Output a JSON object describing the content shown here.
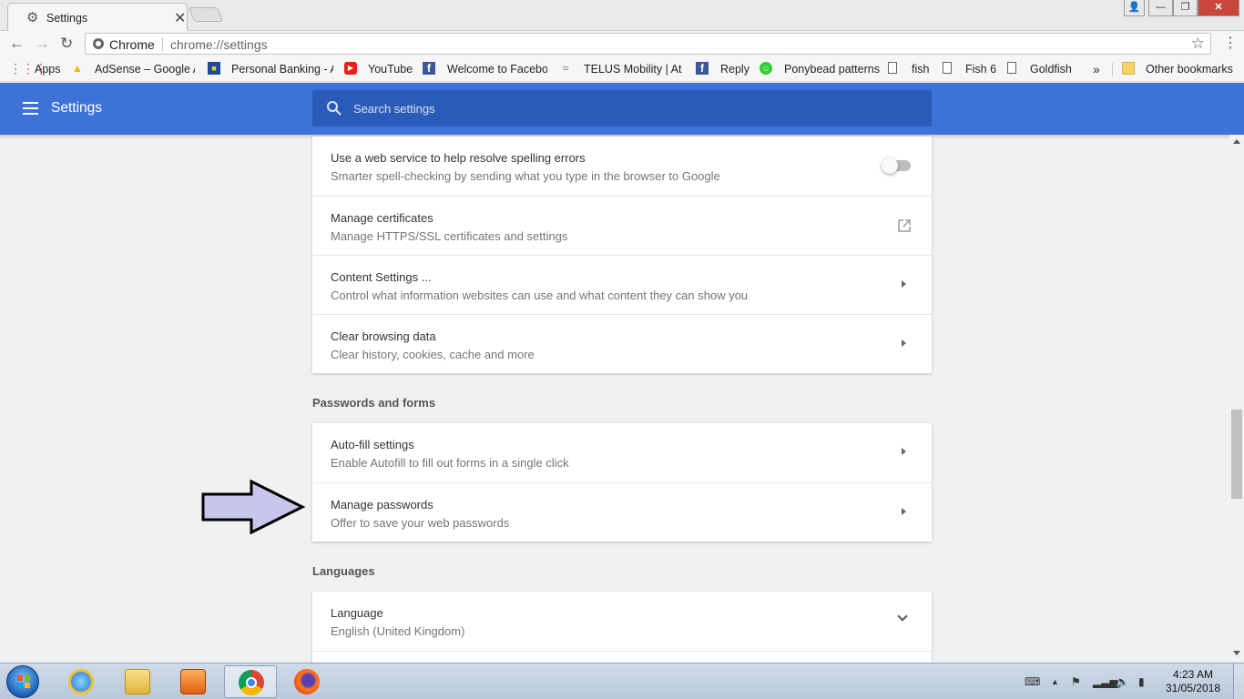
{
  "tab": {
    "title": "Settings",
    "close": "✕"
  },
  "window_controls": {
    "user": "👤",
    "minimize": "—",
    "maximize": "❐",
    "close": "✕"
  },
  "toolbar": {
    "back": "←",
    "forward": "→",
    "reload": "↻",
    "chip_label": "Chrome",
    "url": "chrome://settings",
    "star": "☆",
    "menu": "⋮"
  },
  "bookmarks": {
    "items": [
      {
        "label": "Apps",
        "icon": "apps-grid-icon"
      },
      {
        "label": "AdSense – Google A",
        "icon": "adsense-icon"
      },
      {
        "label": "Personal Banking - A",
        "icon": "bank-icon"
      },
      {
        "label": "YouTube",
        "icon": "youtube-icon"
      },
      {
        "label": "Welcome to Facebo",
        "icon": "facebook-icon"
      },
      {
        "label": "TELUS Mobility | At T",
        "icon": "telus-icon"
      },
      {
        "label": "Reply",
        "icon": "facebook-icon"
      },
      {
        "label": "Ponybead patterns",
        "icon": "ponybead-icon"
      },
      {
        "label": "fish",
        "icon": "page-icon"
      },
      {
        "label": "Fish 6",
        "icon": "page-icon"
      },
      {
        "label": "Goldfish",
        "icon": "page-icon"
      }
    ],
    "overflow": "»",
    "other": "Other bookmarks"
  },
  "header": {
    "title": "Settings",
    "search_placeholder": "Search settings"
  },
  "cards": {
    "advanced": [
      {
        "title": "Use a web service to help resolve spelling errors",
        "subtitle": "Smarter spell-checking by sending what you type in the browser to Google",
        "control": "toggle",
        "enabled": false
      },
      {
        "title": "Manage certificates",
        "subtitle": "Manage HTTPS/SSL certificates and settings",
        "control": "external-link"
      },
      {
        "title": "Content Settings ...",
        "subtitle": "Control what information websites can use and what content they can show you",
        "control": "arrow"
      },
      {
        "title": "Clear browsing data",
        "subtitle": "Clear history, cookies, cache and more",
        "control": "arrow"
      }
    ],
    "passwords_title": "Passwords and forms",
    "passwords": [
      {
        "title": "Auto-fill settings",
        "subtitle": "Enable Autofill to fill out forms in a single click",
        "control": "arrow"
      },
      {
        "title": "Manage passwords",
        "subtitle": "Offer to save your web passwords",
        "control": "arrow"
      }
    ],
    "languages_title": "Languages",
    "languages": [
      {
        "title": "Language",
        "subtitle": "English (United Kingdom)",
        "control": "chevron-down"
      }
    ]
  },
  "taskbar": {
    "clock_time": "4:23 AM",
    "clock_date": "31/05/2018"
  },
  "colors": {
    "header_blue": "#3d73d8",
    "search_blue": "#2b5bb8",
    "annotation_arrow": "#c9c6ee"
  }
}
